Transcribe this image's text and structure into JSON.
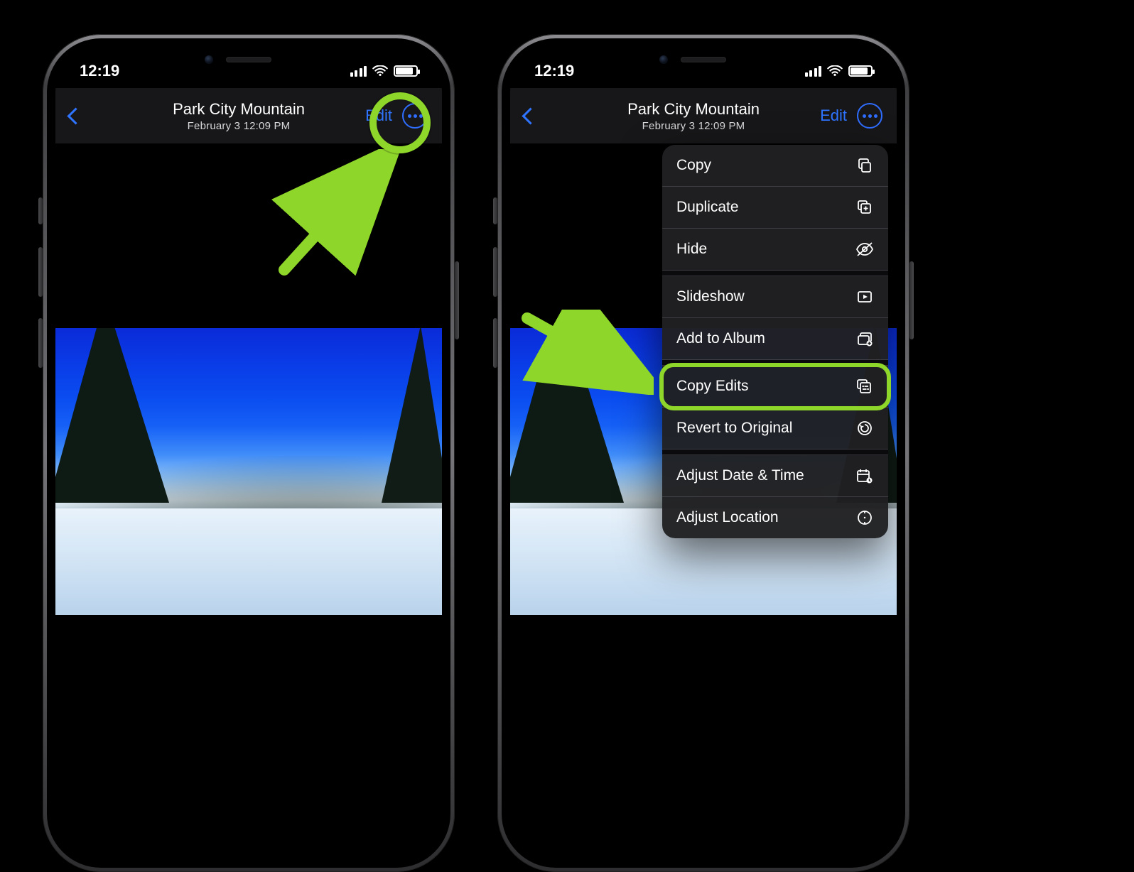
{
  "status": {
    "time": "12:19"
  },
  "header": {
    "title": "Park City Mountain",
    "subtitle": "February 3  12:09 PM",
    "edit": "Edit"
  },
  "menu": {
    "items": [
      {
        "label": "Copy",
        "icon": "copy"
      },
      {
        "label": "Duplicate",
        "icon": "duplicate"
      },
      {
        "label": "Hide",
        "icon": "hide"
      },
      {
        "label": "Slideshow",
        "icon": "slideshow"
      },
      {
        "label": "Add to Album",
        "icon": "add-album"
      },
      {
        "label": "Copy Edits",
        "icon": "copy-edits"
      },
      {
        "label": "Revert to Original",
        "icon": "revert"
      },
      {
        "label": "Adjust Date & Time",
        "icon": "date-time"
      },
      {
        "label": "Adjust Location",
        "icon": "location"
      }
    ]
  },
  "annotation": {
    "highlight_menu_index": 5,
    "accent": "#8fd62a"
  }
}
